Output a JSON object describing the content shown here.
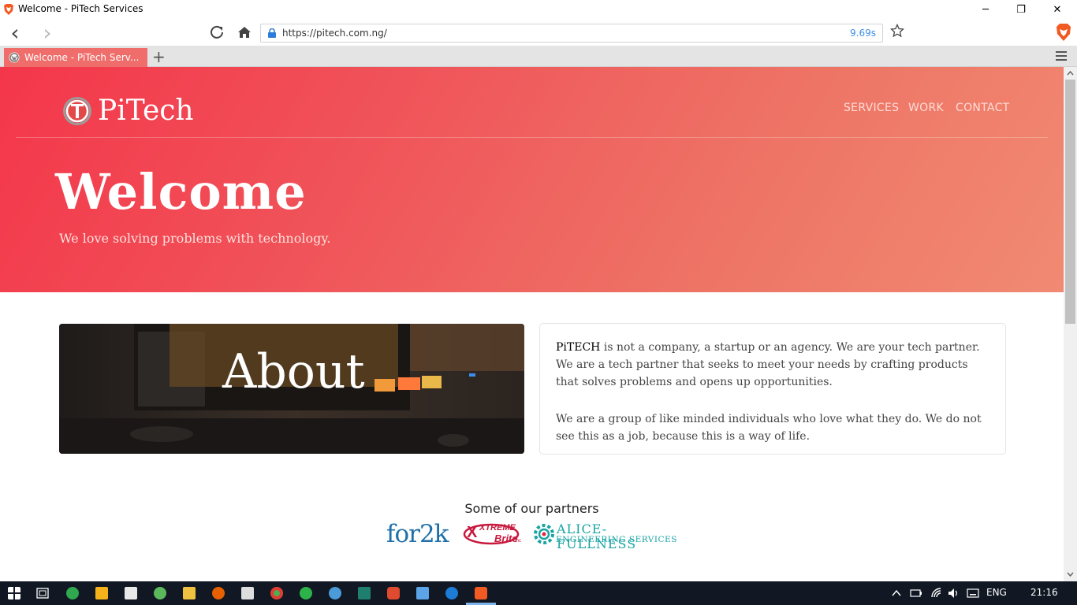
{
  "window": {
    "title": "Welcome - PiTech Services",
    "controls": {
      "minimize": "─",
      "restore": "❐",
      "close": "✕"
    }
  },
  "toolbar": {
    "back_icon": "‹",
    "forward_icon": "›",
    "url": "https://pitech.com.ng/",
    "load_time": "9.69s"
  },
  "tabs": [
    {
      "label": "Welcome - PiTech Serv..."
    }
  ],
  "tabbar": {
    "new_tab": "+"
  },
  "site": {
    "logo_text": "PiTech",
    "nav": [
      "SERVICES",
      "WORK",
      "CONTACT"
    ],
    "hero_title": "Welcome",
    "hero_tagline": "We love solving problems with technology.",
    "about_title": "About",
    "about_brand": "PiTECH",
    "about_p1": " is not a company, a startup or an agency. We are your tech partner. We are a tech partner that seeks to meet your needs by crafting products that solves problems and opens up opportunities.",
    "about_p2": "We are a group of like minded individuals who love what they do. We do not see this as a job, because this is a way of life.",
    "partners_title": "Some of our partners",
    "partners": [
      {
        "name": "for2k"
      },
      {
        "name_line1": "XTREME",
        "name_line2": "Brite",
        "suffix": "Inc"
      },
      {
        "name_line1": "ALICE-FULLNESS",
        "name_line2": "ENGINEERING SERVICES"
      }
    ]
  },
  "taskbar": {
    "language": "ENG",
    "time": "21:16"
  },
  "colors": {
    "hero_start": "#f4364a",
    "hero_end": "#f18a72",
    "tab_active": "#ef6e6b",
    "taskbar": "#111823",
    "partner_for2k": "#1f6fa8",
    "partner_xtreme": "#c8183d",
    "partner_alice": "#19a3a3"
  }
}
